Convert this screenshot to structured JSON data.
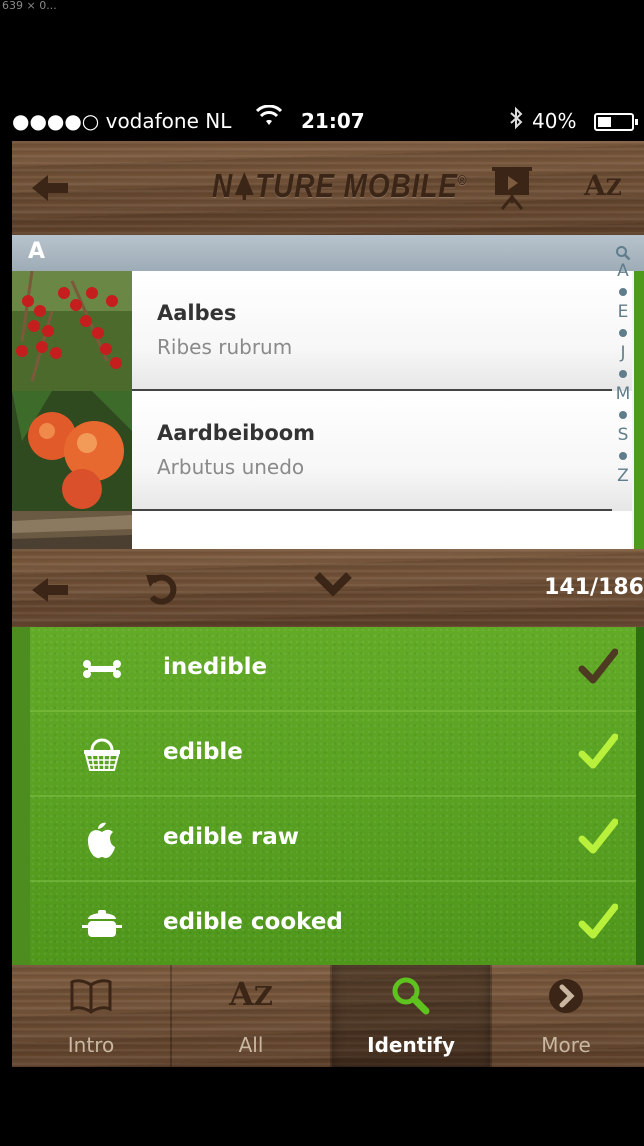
{
  "page_meta": "639 × 0...",
  "status_bar": {
    "carrier": "●●●●○ vodafone NL",
    "time": "21:07",
    "battery": "40%",
    "battery_level": 0.4,
    "icons": [
      "wifi-icon",
      "bluetooth-icon",
      "battery-icon"
    ]
  },
  "header": {
    "back_icon": "arrow-left-icon",
    "logo_part1": "N",
    "logo_part2": "TURE MOBILE",
    "logo_reg": "®",
    "presentation_icon": "presentation-icon",
    "az_main": "A",
    "az_sub": "Z"
  },
  "list": {
    "section_letter": "A",
    "items": [
      {
        "name": "Aalbes",
        "latin": "Ribes rubrum"
      },
      {
        "name": "Aardbeiboom",
        "latin": "Arbutus unedo"
      }
    ],
    "index": [
      "A",
      "E",
      "J",
      "M",
      "S",
      "Z"
    ]
  },
  "toolbar": {
    "back_icon": "arrow-left-icon",
    "reset_icon": "reset-icon",
    "collapse_icon": "chevron-down-icon",
    "count": "141/186"
  },
  "filters": [
    {
      "label": "inedible",
      "icon": "bone-icon",
      "checked": false
    },
    {
      "label": "edible",
      "icon": "basket-icon",
      "checked": true
    },
    {
      "label": "edible raw",
      "icon": "apple-icon",
      "checked": true
    },
    {
      "label": "edible cooked",
      "icon": "pot-icon",
      "checked": true
    }
  ],
  "tabs": [
    {
      "label": "Intro",
      "icon": "book-icon",
      "active": false
    },
    {
      "label": "All",
      "icon": "az-icon",
      "active": false,
      "icon_text_main": "A",
      "icon_text_sub": "Z"
    },
    {
      "label": "Identify",
      "icon": "search-icon",
      "active": true
    },
    {
      "label": "More",
      "icon": "more-icon",
      "active": false
    }
  ],
  "colors": {
    "wood": "#6b4a30",
    "filter_green": "#5aa321",
    "check_active": "#b8f03c",
    "check_inactive": "#4e3a22"
  }
}
